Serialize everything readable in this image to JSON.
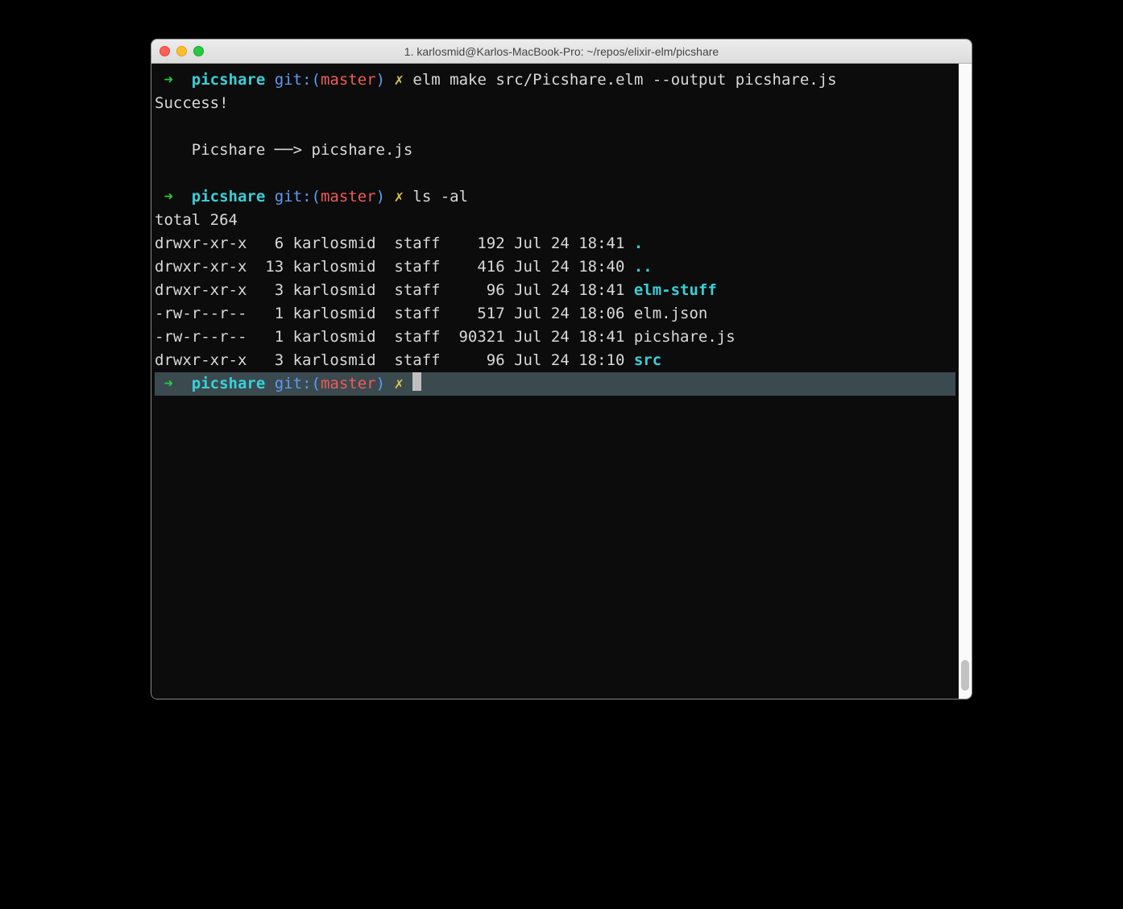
{
  "window": {
    "title": "1. karlosmid@Karlos-MacBook-Pro: ~/repos/elixir-elm/picshare"
  },
  "prompt": {
    "arrow": "➜",
    "cwd": "picshare",
    "git_label": "git:(",
    "branch": "master",
    "git_close": ")",
    "mark": "✗"
  },
  "cmd1": "elm make src/Picshare.elm --output picshare.js",
  "out1_line1": "Success!",
  "out1_line2": "    Picshare ──> picshare.js",
  "cmd2": "ls -al",
  "ls": {
    "total": "total 264",
    "rows": [
      {
        "perm": "drwxr-xr-x",
        "links": "  6",
        "user": "karlosmid",
        "group": " staff",
        "size": "   192",
        "date": "Jul 24 18:41",
        "name": ".",
        "dir": true
      },
      {
        "perm": "drwxr-xr-x",
        "links": " 13",
        "user": "karlosmid",
        "group": " staff",
        "size": "   416",
        "date": "Jul 24 18:40",
        "name": "..",
        "dir": true
      },
      {
        "perm": "drwxr-xr-x",
        "links": "  3",
        "user": "karlosmid",
        "group": " staff",
        "size": "    96",
        "date": "Jul 24 18:41",
        "name": "elm-stuff",
        "dir": true
      },
      {
        "perm": "-rw-r--r--",
        "links": "  1",
        "user": "karlosmid",
        "group": " staff",
        "size": "   517",
        "date": "Jul 24 18:06",
        "name": "elm.json",
        "dir": false
      },
      {
        "perm": "-rw-r--r--",
        "links": "  1",
        "user": "karlosmid",
        "group": " staff",
        "size": " 90321",
        "date": "Jul 24 18:41",
        "name": "picshare.js",
        "dir": false
      },
      {
        "perm": "drwxr-xr-x",
        "links": "  3",
        "user": "karlosmid",
        "group": " staff",
        "size": "    96",
        "date": "Jul 24 18:10",
        "name": "src",
        "dir": true
      }
    ]
  }
}
